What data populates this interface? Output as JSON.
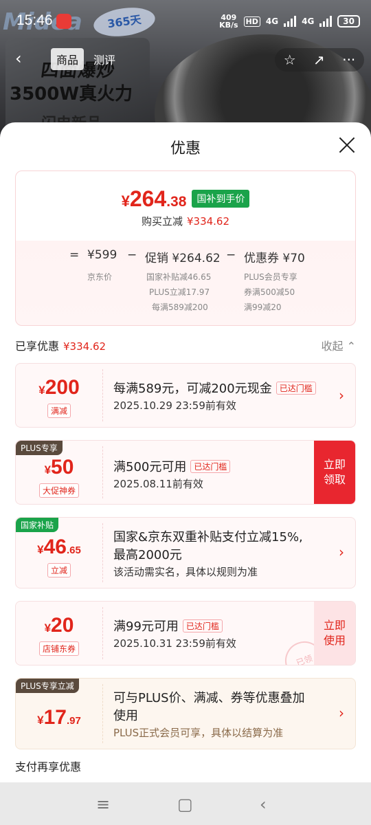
{
  "status_bar": {
    "time": "15:46",
    "speed_top": "409",
    "speed_bottom": "KB/s",
    "hd": "HD",
    "net1": "4G",
    "net2": "4G",
    "battery": "30"
  },
  "background": {
    "logo": "Midea",
    "badge": "365天",
    "banner_line1": "四面爆炒",
    "banner_line2": "3500W真火力",
    "banner_line3": "闪电新品",
    "tabs": [
      "商品",
      "测评"
    ]
  },
  "sheet": {
    "title": "优惠"
  },
  "summary": {
    "price_symbol": "¥",
    "price_int": "264",
    "price_dec": ".38",
    "tag": "国补到手价",
    "saved_label": "购买立减",
    "saved_value": "¥334.62",
    "eq": "=",
    "orig": "¥599",
    "orig_label": "京东价",
    "minus1": "−",
    "promo": "促销 ¥264.62",
    "promo_sub": [
      "国家补贴减46.65",
      "PLUS立减17.97",
      "每满589减200"
    ],
    "minus2": "−",
    "coupon": "优惠券 ¥70",
    "coupon_sub": [
      "PLUS会员专享",
      "券满500减50",
      "满99减20"
    ]
  },
  "enjoyed": {
    "label": "已享优惠",
    "value": "¥334.62",
    "collapse": "收起 ⌃"
  },
  "cards": [
    {
      "sym": "¥",
      "amount": "200",
      "dec": "",
      "tag": "满减",
      "corner": "",
      "line1": "每满589元，可减200元现金",
      "badge": "已达门槛",
      "line2": "2025.10.29 23:59前有效",
      "line3": "",
      "action": ""
    },
    {
      "sym": "¥",
      "amount": "50",
      "dec": "",
      "tag": "大促神券",
      "corner": "PLUS专享",
      "line1": "满500元可用",
      "badge": "已达门槛",
      "line2": "2025.08.11前有效",
      "line3": "",
      "action": "立即领取"
    },
    {
      "sym": "¥",
      "amount": "46",
      "dec": ".65",
      "tag": "立减",
      "corner": "国家补贴",
      "line1": "国家&京东双重补贴支付立减15%,",
      "badge": "",
      "line2": "最高2000元",
      "line3": "该活动需实名，具体以规则为准",
      "action": ""
    },
    {
      "sym": "¥",
      "amount": "20",
      "dec": "",
      "tag": "店铺东券",
      "corner": "",
      "line1": "满99元可用",
      "badge": "已达门槛",
      "line2": "2025.10.31 23:59前有效",
      "line3": "",
      "action": "立即使用",
      "stamp": "已领"
    },
    {
      "sym": "¥",
      "amount": "17",
      "dec": ".97",
      "tag": "",
      "corner": "PLUS专享立减",
      "line1": "可与PLUS价、满减、券等优惠叠加",
      "badge": "",
      "line2": "使用",
      "line3": "PLUS正式会员可享，具体以结算为准",
      "action": ""
    }
  ],
  "pay_more": "支付再享优惠",
  "colors": {
    "accent": "#e1251b",
    "green": "#1aa34a",
    "plus_corner": "#5a4a3d",
    "gov_corner": "#1aa34a",
    "plus_card_bg": "#fdf6ef"
  }
}
